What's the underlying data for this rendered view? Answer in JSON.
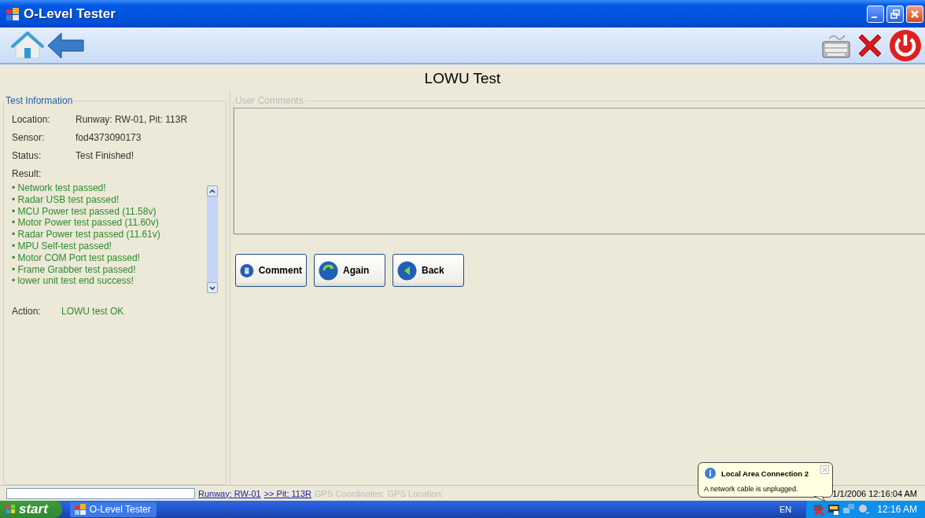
{
  "window": {
    "title": "O-Level Tester"
  },
  "heading": "LOWU Test",
  "test_info": {
    "legend": "Test Information",
    "fields": [
      {
        "label": "Location:",
        "value": "Runway: RW-01, Pit: 113R"
      },
      {
        "label": "Sensor:",
        "value": "fod4373090173"
      },
      {
        "label": "Status:",
        "value": "Test Finished!"
      }
    ],
    "result_label": "Result:",
    "results": [
      "• Network test passed!",
      "• Radar USB test passed!",
      "• MCU Power test passed (11.58v)",
      "• Motor Power test passed (11.60v)",
      "• Radar Power test passed (11.61v)",
      "• MPU Self-test passed!",
      "• Motor COM Port test passed!",
      "• Frame Grabber test passed!",
      "• lower unit test end success!"
    ],
    "action": {
      "label": "Action:",
      "value": "LOWU test OK"
    }
  },
  "comments": {
    "legend": "User Comments"
  },
  "buttons": [
    {
      "label": "Comment",
      "kind": "comment"
    },
    {
      "label": "Again",
      "kind": "again"
    },
    {
      "label": "Back",
      "kind": "back"
    }
  ],
  "status_bar": {
    "runway": "Runway: RW-01",
    "pit": ">> Pit:  113R",
    "gps_coordinates": "GPS Coordinates:",
    "gps_location": "GPS Location:",
    "datetime": "1/1/2006 12:16:04 AM"
  },
  "taskbar": {
    "start": "start",
    "task": "O-Level Tester",
    "language": "EN",
    "clock": "12:16 AM"
  },
  "balloon": {
    "title": "Local Area Connection 2",
    "message": "A network cable is unplugged."
  }
}
